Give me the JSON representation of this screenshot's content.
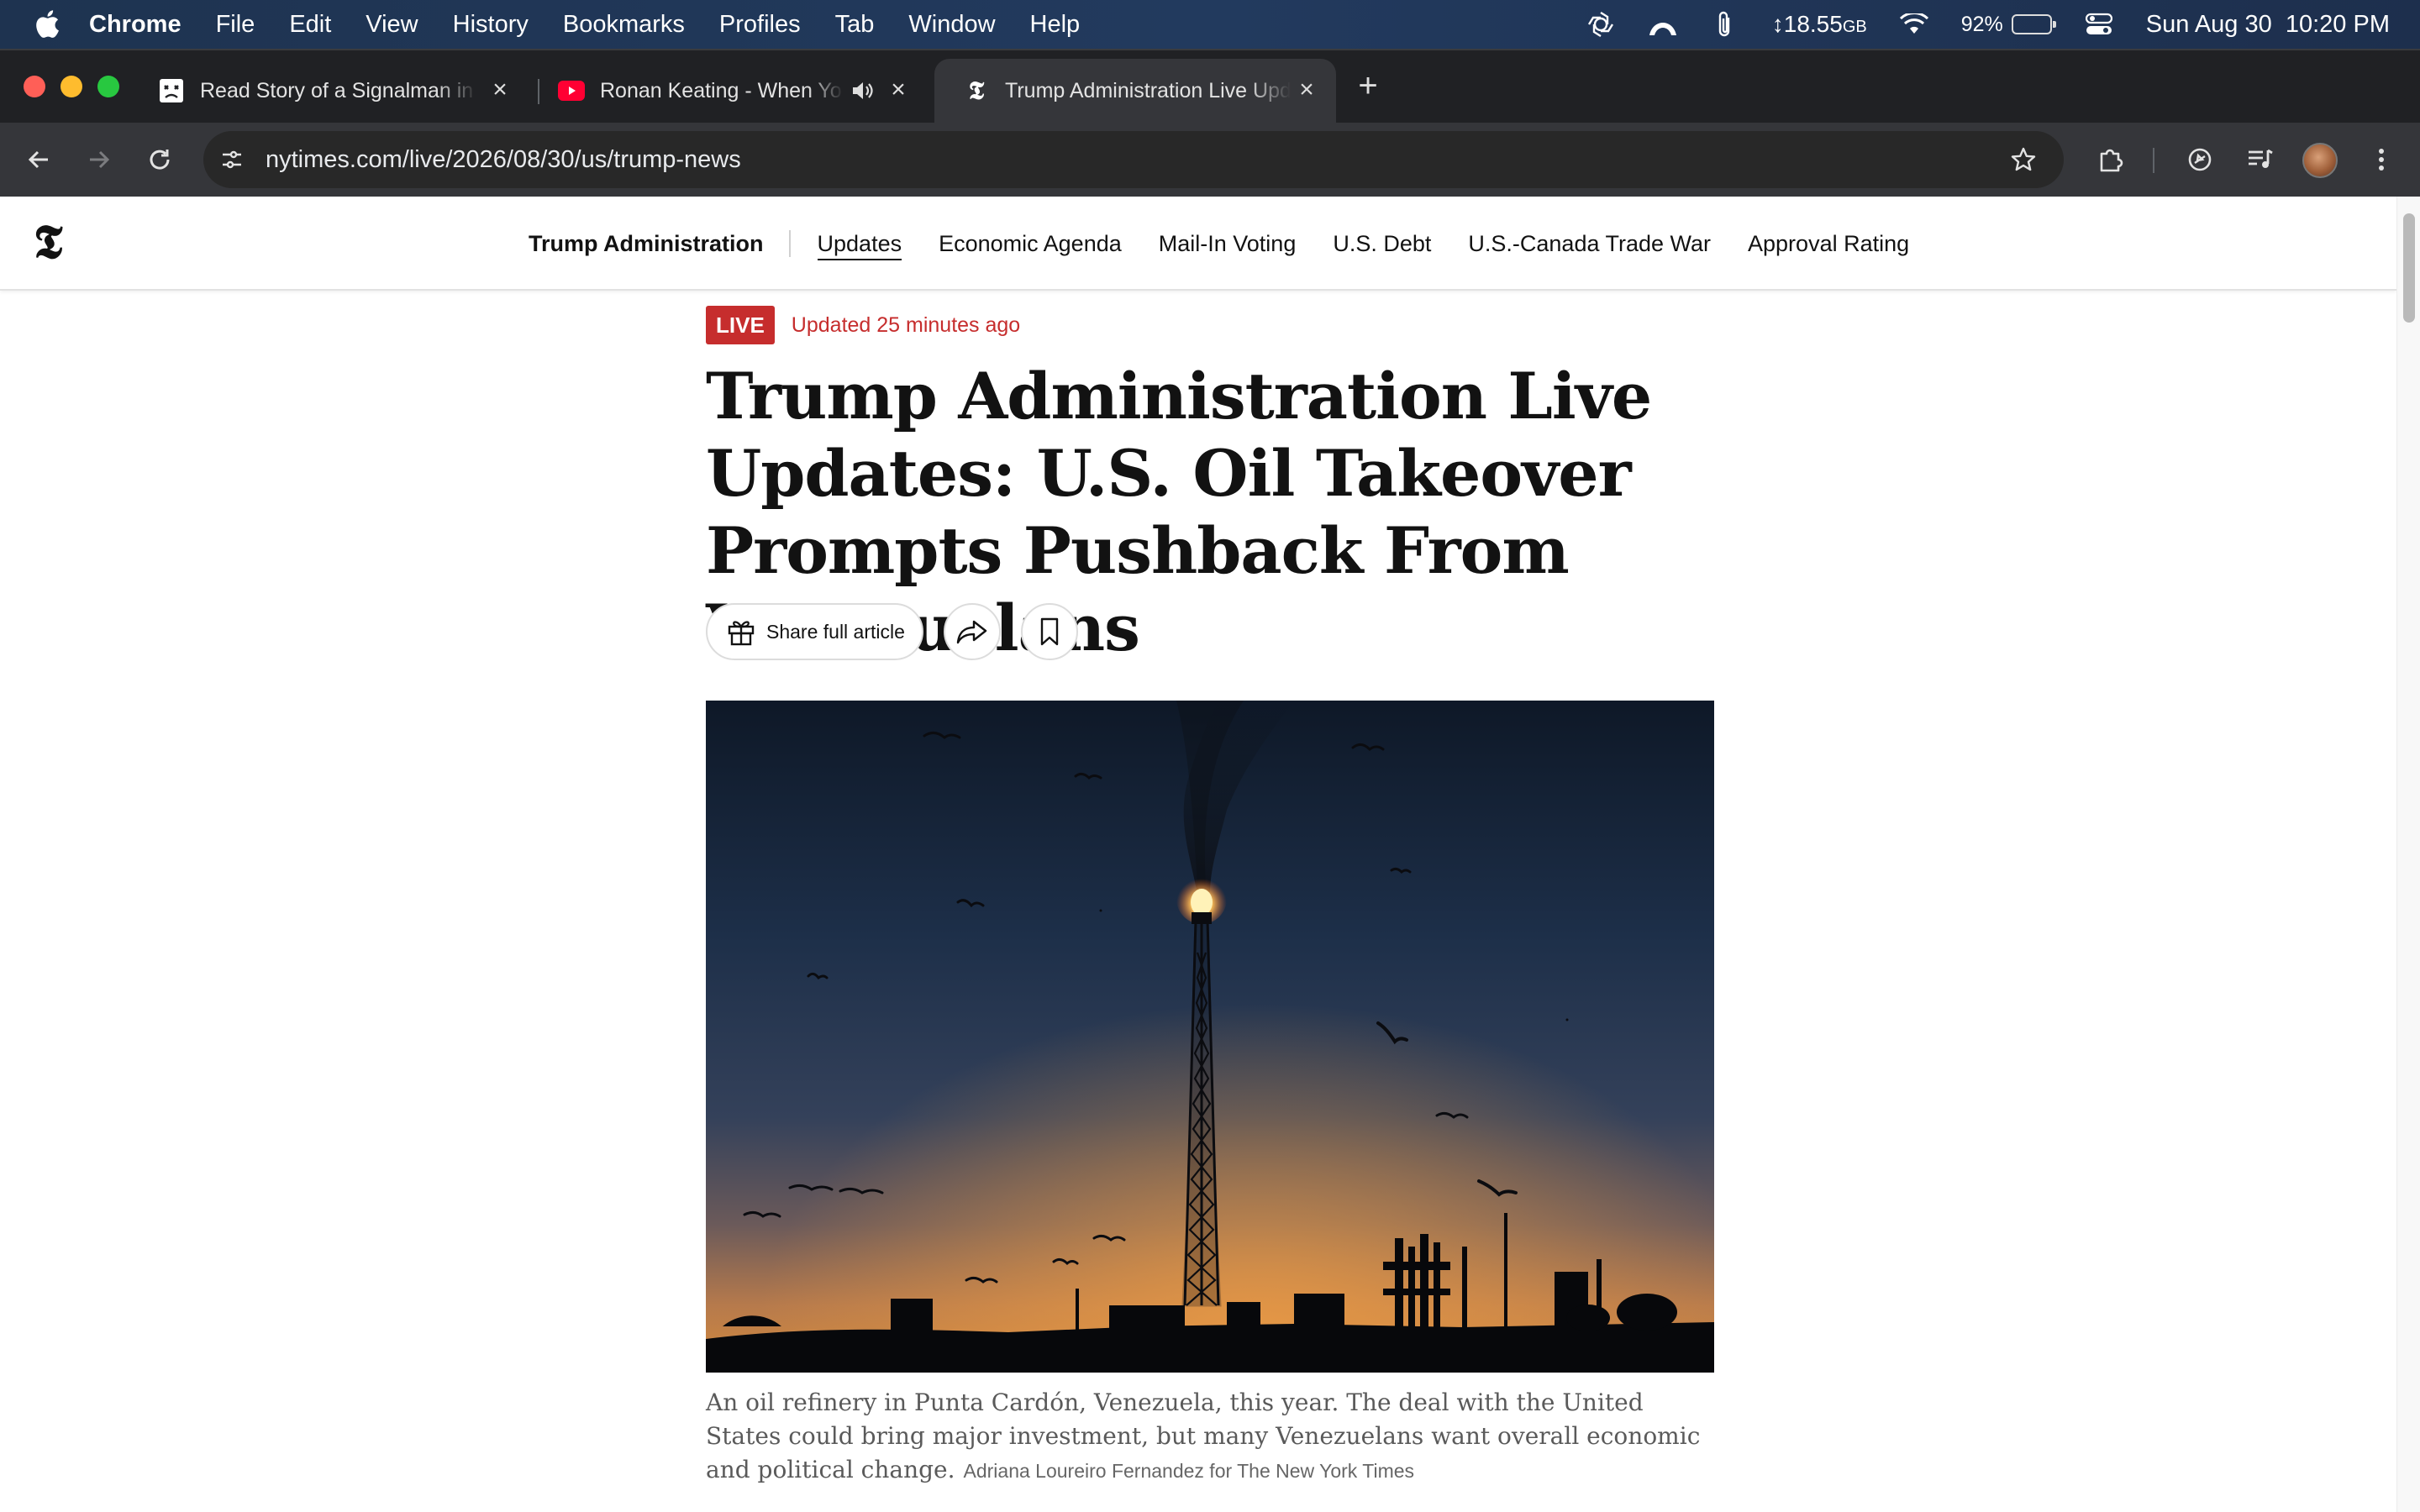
{
  "menubar": {
    "app_name": "Chrome",
    "menus": [
      "File",
      "Edit",
      "View",
      "History",
      "Bookmarks",
      "Profiles",
      "Tab",
      "Window",
      "Help"
    ],
    "memory": "18.55",
    "memory_unit": "GB",
    "battery_percent": "92%",
    "battery_level": 0.92,
    "datetime": "Sun Aug 30  10:20 PM"
  },
  "tabs": [
    {
      "title": "Read Story of a Signalman in",
      "icon": "reader-icon"
    },
    {
      "title": "Ronan Keating - When You Say Nothing At All",
      "icon": "youtube-icon",
      "audio": true
    },
    {
      "title": "Trump Administration Live Updates",
      "icon": "nyt-icon",
      "active": true
    }
  ],
  "toolbar": {
    "url": "nytimes.com/live/2026/08/30/us/trump-news"
  },
  "nyt": {
    "logo": "𝕿",
    "section": "Trump Administration",
    "nav": [
      "Updates",
      "Economic Agenda",
      "Mail-In Voting",
      "U.S. Debt",
      "U.S.-Canada Trade War",
      "Approval Rating"
    ],
    "live_label": "LIVE",
    "updated": "Updated 25 minutes ago",
    "headline": "Trump Administration Live Updates: U.S. Oil Takeover Prompts Pushback From Venezuelans",
    "share_label": "Share full article",
    "caption": "An oil refinery in Punta Cardón, Venezuela, this year. The deal with the United States could bring major investment, but many Venezuelans want overall economic and political change.",
    "credit": "Adriana Loureiro Fernandez for The New York Times"
  },
  "colors": {
    "live_red": "#c62d2d",
    "chrome_dark": "#202124",
    "chrome_toolbar": "#35363a"
  }
}
